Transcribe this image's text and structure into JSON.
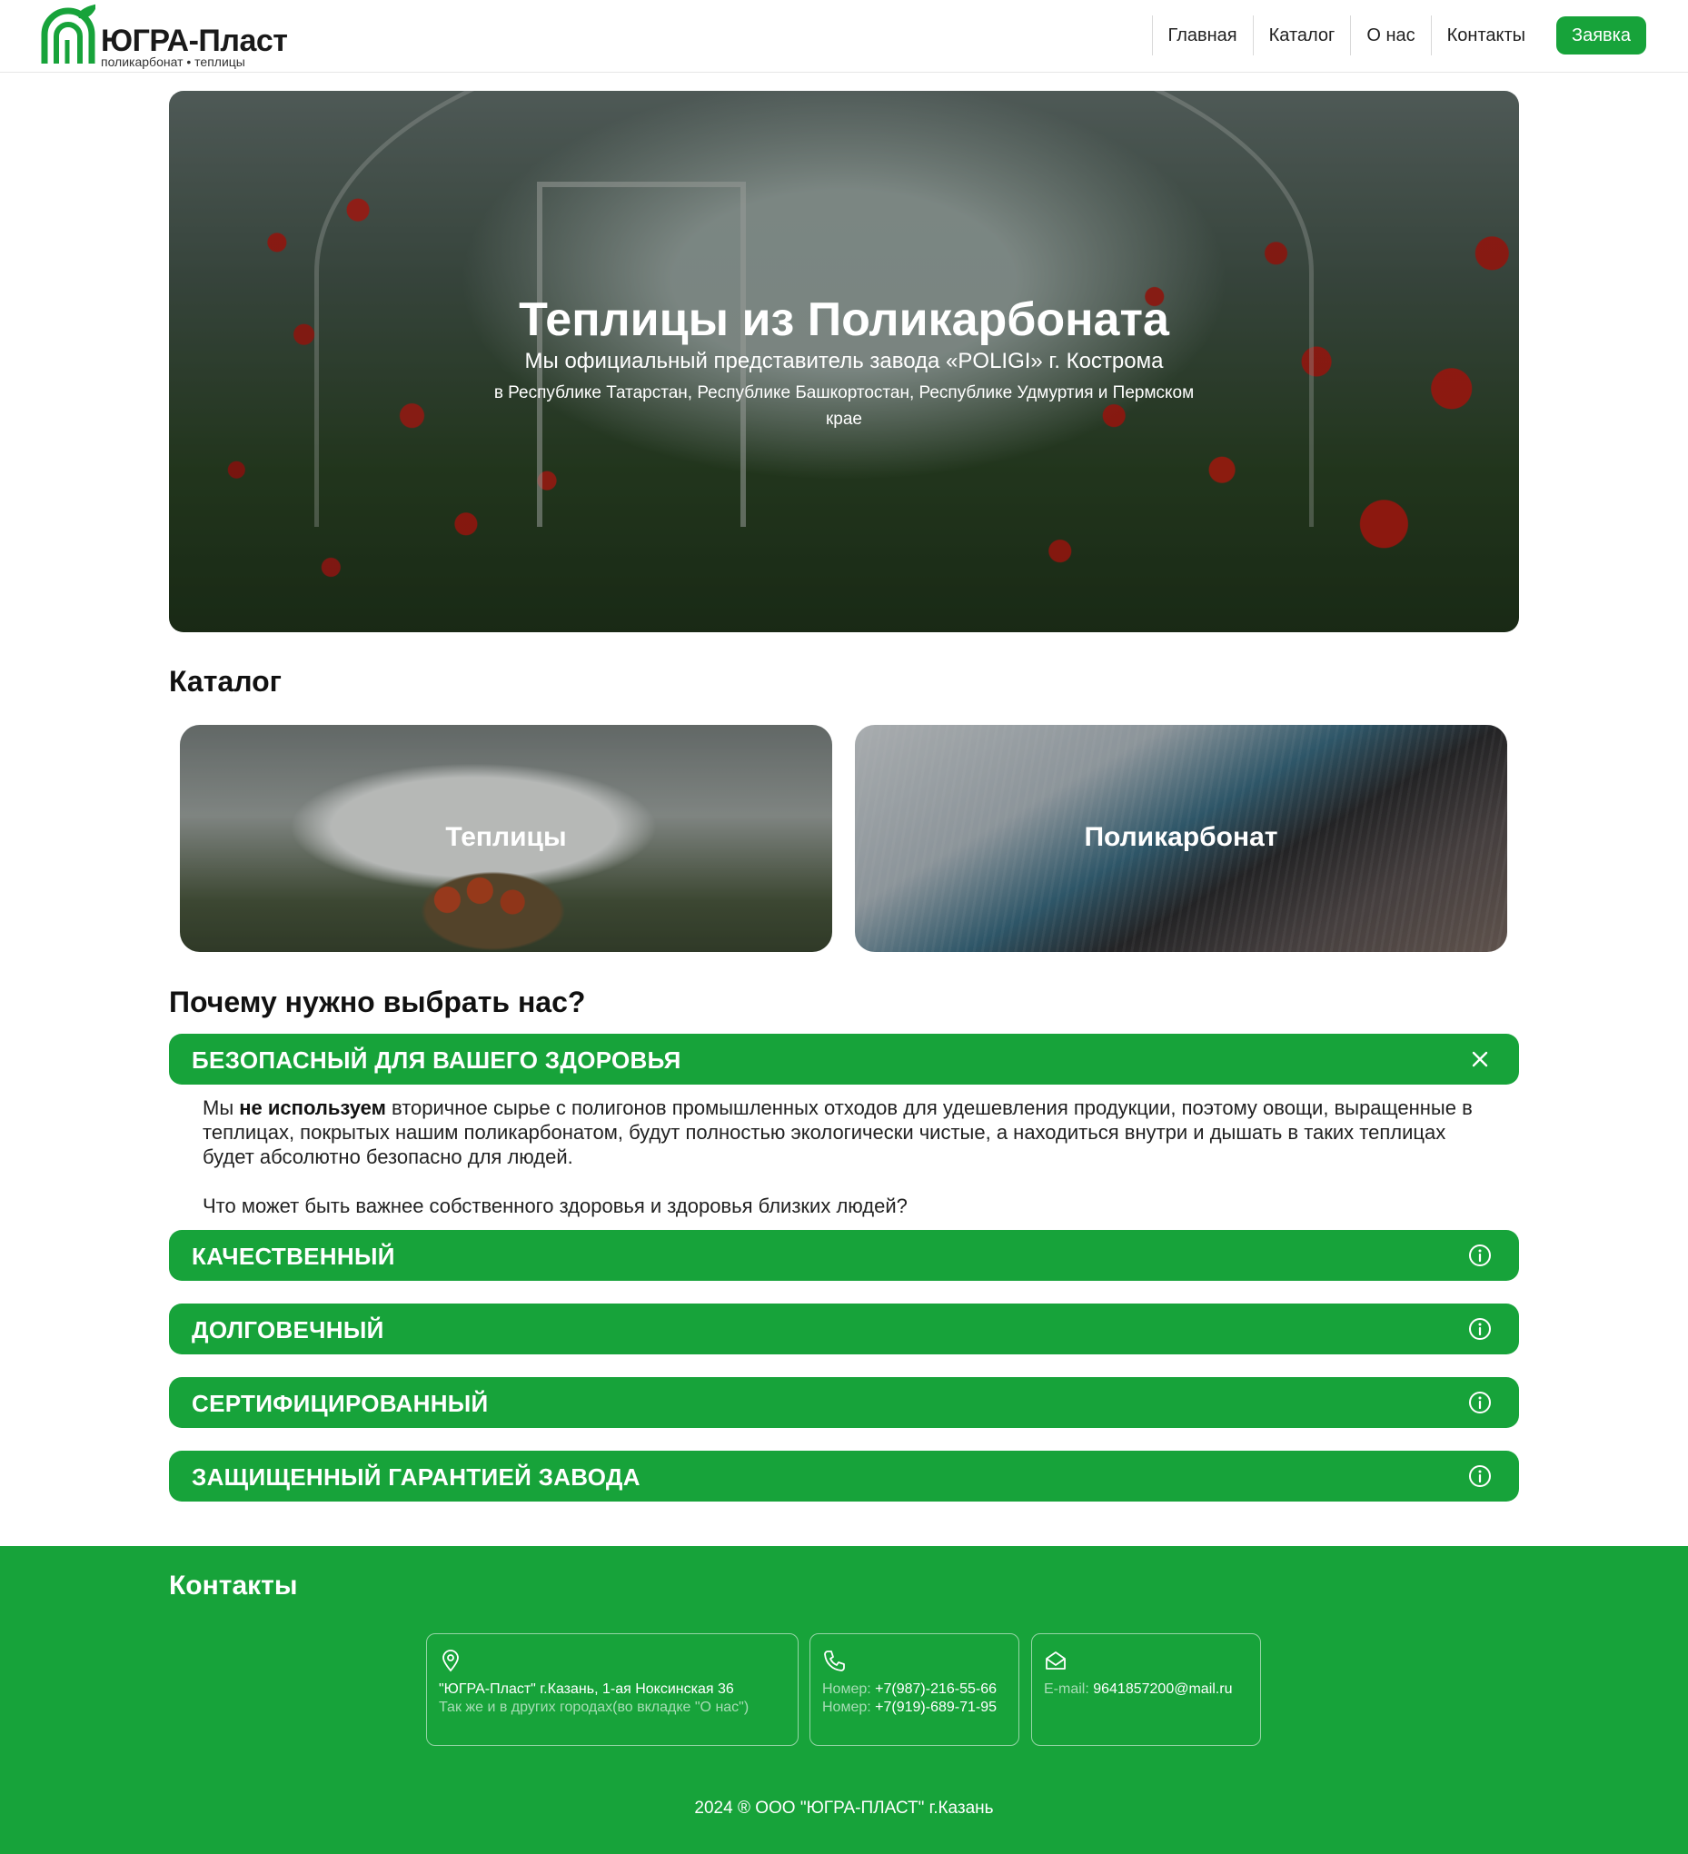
{
  "brand": {
    "name": "ЮГРА-Пласт",
    "tagline": "поликарбонат • теплицы",
    "color": "#17a33a"
  },
  "nav": {
    "items": [
      {
        "label": "Главная"
      },
      {
        "label": "Каталог"
      },
      {
        "label": "О нас"
      },
      {
        "label": "Контакты"
      }
    ],
    "cta": "Заявка"
  },
  "hero": {
    "title": "Теплицы из Поликарбоната",
    "subtitle": "Мы официальный представитель завода «POLIGI» г. Кострома",
    "regions": "в Республике Татарстан, Республике Башкортостан, Республике Удмуртия и Пермском крае"
  },
  "catalog": {
    "title": "Каталог",
    "cards": [
      {
        "label": "Теплицы"
      },
      {
        "label": "Поликарбонат"
      }
    ]
  },
  "why": {
    "title": "Почему нужно выбрать нас?",
    "items": [
      {
        "label": "БЕЗОПАСНЫЙ ДЛЯ ВАШЕГО ЗДОРОВЬЯ",
        "state": "open",
        "icon": "close-icon"
      },
      {
        "label": "КАЧЕСТВЕННЫЙ",
        "state": "closed",
        "icon": "info-icon"
      },
      {
        "label": "ДОЛГОВЕЧНЫЙ",
        "state": "closed",
        "icon": "info-icon"
      },
      {
        "label": "СЕРТИФИЦИРОВАННЫЙ",
        "state": "closed",
        "icon": "info-icon"
      },
      {
        "label": "ЗАЩИЩЕННЫЙ ГАРАНТИЕЙ ЗАВОДА",
        "state": "closed",
        "icon": "info-icon"
      }
    ],
    "open_body": {
      "p1_prefix": "Мы ",
      "p1_bold": "не используем",
      "p1_suffix": " вторичное сырье с полигонов промышленных отходов для удешевления продукции, поэтому овощи, выращенные в теплицах, покрытых нашим поликарбонатом, будут полностью экологически чистые, а находиться внутри и дышать в таких теплицах будет абсолютно безопасно для людей.",
      "p2": "Что может быть важнее собственного здоровья и здоровья близких людей?"
    }
  },
  "footer": {
    "title": "Контакты",
    "address": {
      "line1": "\"ЮГРА-Пласт\" г.Казань, 1-ая Ноксинская 36",
      "line2": "Так же и в других городах(во вкладке \"О нас\")"
    },
    "phones": {
      "label": "Номер:",
      "phone1": "+7(987)-216-55-66",
      "phone2": "+7(919)-689-71-95"
    },
    "email": {
      "label": "E-mail:",
      "value": "9641857200@mail.ru"
    },
    "copyright": "2024 ® ООО \"ЮГРА-ПЛАСТ\" г.Казань"
  }
}
